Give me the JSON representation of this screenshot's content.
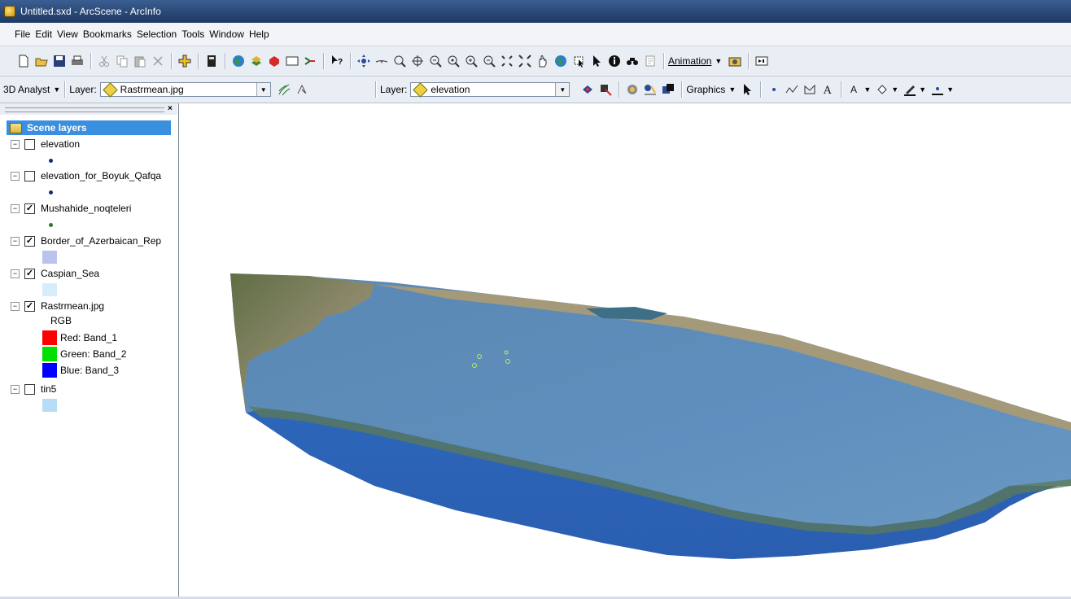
{
  "window": {
    "title": "Untitled.sxd - ArcScene - ArcInfo"
  },
  "menu": [
    "File",
    "Edit",
    "View",
    "Bookmarks",
    "Selection",
    "Tools",
    "Window",
    "Help"
  ],
  "toolbar_main": {
    "animation_label": "Animation",
    "icons": [
      "new-icon",
      "open-icon",
      "save-icon",
      "print-icon",
      "cut-icon",
      "copy-icon",
      "paste-icon",
      "delete-icon",
      "add-data-icon",
      "arctoolbox-icon",
      "globe-icon",
      "layers-icon",
      "red-layers-icon",
      "frame-icon",
      "connect-icon",
      "whats-this-icon",
      "navigate-icon",
      "fly-icon",
      "target-zoom-icon",
      "center-icon",
      "zoom-target-icon",
      "set-observer-icon",
      "zoom-in-icon",
      "zoom-out-icon",
      "full-extent-icon",
      "extent-icon",
      "pan-icon",
      "globe-view-icon",
      "select-features-icon",
      "select-element-icon",
      "identify-icon",
      "find-icon",
      "properties-icon"
    ]
  },
  "toolbar_3d": {
    "analyst_label": "3D Analyst",
    "layer_label": "Layer:",
    "layer_value": "Rastrmean.jpg",
    "layer2_label": "Layer:",
    "layer2_value": "elevation",
    "graphics_label": "Graphics"
  },
  "toc": {
    "header": "Scene layers",
    "layers": [
      {
        "name": "elevation",
        "checked": false
      },
      {
        "name": "elevation_for_Boyuk_Qafqa",
        "checked": false
      },
      {
        "name": "Mushahide_noqteleri",
        "checked": true
      },
      {
        "name": "Border_of_Azerbaican_Rep",
        "checked": true
      },
      {
        "name": "Caspian_Sea",
        "checked": true
      },
      {
        "name": "Rastrmean.jpg",
        "checked": true
      },
      {
        "name": "tin5",
        "checked": false
      }
    ],
    "rgb_label": "RGB",
    "bands": [
      {
        "label": "Red:  Band_1",
        "color": "#ff0000"
      },
      {
        "label": "Green: Band_2",
        "color": "#00e000"
      },
      {
        "label": "Blue:  Band_3",
        "color": "#0000ff"
      }
    ],
    "symbol_colors": {
      "elevation": "#1a2a7a",
      "elevation_for_Boyuk_Qafqa": "#1a2a7a",
      "Mushahide_noqteleri": "#2d7a2d",
      "Border_of_Azerbaican_Rep": "#b9c3ec",
      "Caspian_Sea": "#d6ecfb",
      "tin5": "#b8dcf6"
    }
  },
  "scene": {
    "colors": {
      "sea": "#5a87b5",
      "sea_base": "#2c62b8",
      "land": "#6b7a52",
      "land_light": "#9c9170"
    }
  }
}
